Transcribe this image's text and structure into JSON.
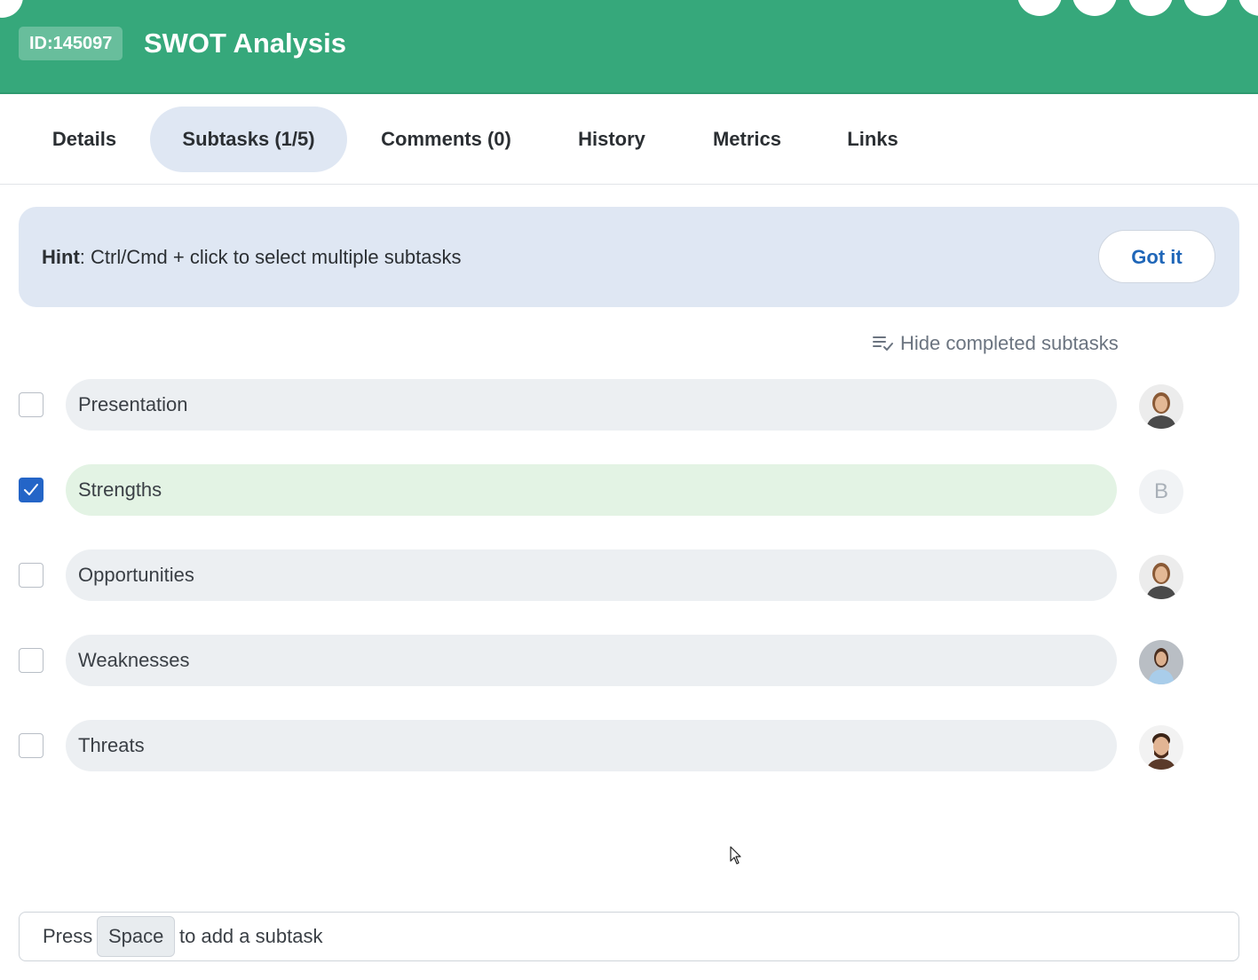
{
  "header": {
    "id_badge": "ID:145097",
    "title": "SWOT Analysis",
    "accent_color": "#36a87b"
  },
  "tabs": [
    {
      "label": "Details",
      "active": false
    },
    {
      "label": "Subtasks (1/5)",
      "active": true
    },
    {
      "label": "Comments (0)",
      "active": false
    },
    {
      "label": "History",
      "active": false
    },
    {
      "label": "Metrics",
      "active": false
    },
    {
      "label": "Links",
      "active": false
    }
  ],
  "hint": {
    "bold": "Hint",
    "text": ": Ctrl/Cmd + click to select multiple subtasks",
    "button": "Got it"
  },
  "hide_completed": {
    "label": "Hide completed subtasks",
    "icon": "list-check-icon"
  },
  "subtasks": [
    {
      "name": "Presentation",
      "checked": false,
      "assignee": "woman-dark-hair-avatar"
    },
    {
      "name": "Strengths",
      "checked": true,
      "assignee_initial": "B"
    },
    {
      "name": "Opportunities",
      "checked": false,
      "assignee": "woman-dark-hair-avatar"
    },
    {
      "name": "Weaknesses",
      "checked": false,
      "assignee": "woman-blue-shirt-avatar"
    },
    {
      "name": "Threats",
      "checked": false,
      "assignee": "bearded-man-avatar"
    }
  ],
  "add_bar": {
    "prefix": "Press",
    "key": "Space",
    "suffix": "to add a subtask"
  }
}
